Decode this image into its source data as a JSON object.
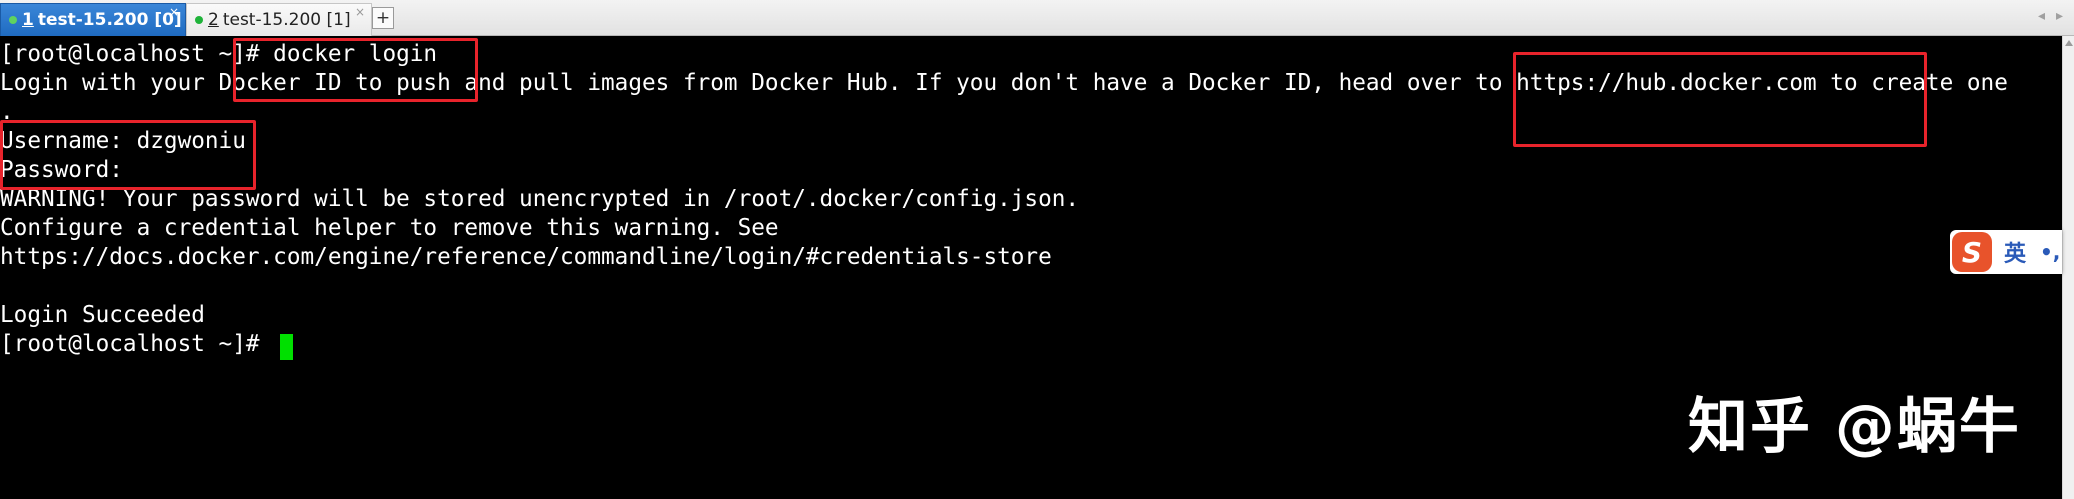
{
  "tabs": [
    {
      "number": "1",
      "label": "test-15.200 [0]",
      "active": true,
      "close": "×"
    },
    {
      "number": "2",
      "label": "test-15.200 [1]",
      "active": false,
      "close": "×"
    }
  ],
  "tab_add_label": "+",
  "tab_nav": {
    "prev": "◂",
    "next": "▸"
  },
  "terminal": {
    "lines": [
      "[root@localhost ~]# docker login",
      "Login with your Docker ID to push and pull images from Docker Hub. If you don't have a Docker ID, head over to https://hub.docker.com to create one",
      ".",
      "Username: dzgwoniu",
      "Password:",
      "WARNING! Your password will be stored unencrypted in /root/.docker/config.json.",
      "Configure a credential helper to remove this warning. See",
      "https://docs.docker.com/engine/reference/commandline/login/#credentials-store",
      "",
      "Login Succeeded",
      "[root@localhost ~]# "
    ]
  },
  "ime": {
    "logo": "S",
    "language": "英",
    "punctuation": "•,"
  },
  "watermark": "知乎 @蜗牛",
  "colors": {
    "terminal_bg": "#000000",
    "terminal_fg": "#ffffff",
    "cursor": "#00e000",
    "highlight": "#e8232b",
    "tab_active": "#1f6bc1"
  }
}
